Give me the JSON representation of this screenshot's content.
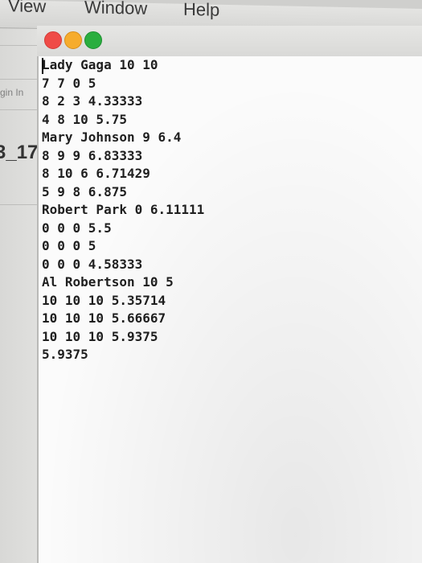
{
  "menubar": {
    "items": [
      "View",
      "Window",
      "Help"
    ]
  },
  "background_window": {
    "text_fragment_1": "gin In",
    "text_fragment_2": "3_17"
  },
  "console": {
    "lines": [
      "Lady Gaga 10 10",
      "7 7 0 5",
      "8 2 3 4.33333",
      "4 8 10 5.75",
      "Mary Johnson 9 6.4",
      "8 9 9 6.83333",
      "8 10 6 6.71429",
      "5 9 8 6.875",
      "Robert Park 0 6.11111",
      "0 0 0 5.5",
      "0 0 0 5",
      "0 0 0 4.58333",
      "Al Robertson 10 5",
      "10 10 10 5.35714",
      "10 10 10 5.66667",
      "10 10 10 5.9375",
      "5.9375"
    ]
  },
  "colors": {
    "close": "#ef4b47",
    "minimize": "#f6ac2d",
    "zoom": "#2aae3f"
  }
}
